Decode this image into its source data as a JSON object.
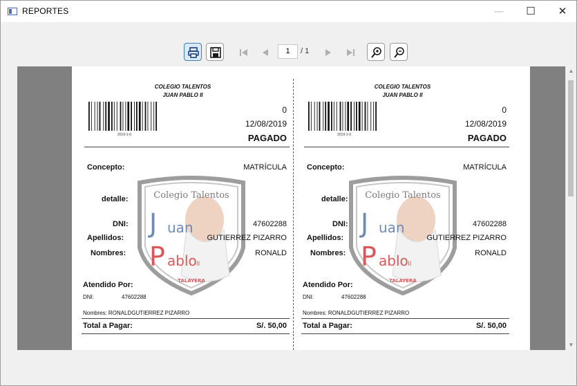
{
  "window": {
    "title": "REPORTES",
    "minimize": "—",
    "maximize": "☐",
    "close": "✕"
  },
  "toolbar": {
    "page_current": "1",
    "page_total": "/ 1"
  },
  "receipts": [
    {
      "school_line1": "COLEGIO TALENTOS",
      "school_line2": "JUAN PABLO II",
      "barcode_text": "2019-1-0",
      "number": "0",
      "date": "12/08/2019",
      "status": "PAGADO",
      "concepto_label": "Concepto:",
      "concepto_value": "MATRÍCULA",
      "detalle_label": "detalle:",
      "dni_label": "DNI:",
      "dni_value": "47602288",
      "apellidos_label": "Apellidos:",
      "apellidos_value": "GUTIERREZ PIZARRO",
      "nombres_label": "Nombres:",
      "nombres_value": "RONALD",
      "atendido_label": "Atendido Por:",
      "atendido_dni_label": "DNI:",
      "atendido_dni_value": "47602288",
      "atendido_nombres": "Nombres: RONALDGUTIERREZ PIZARRO",
      "total_label": "Total a Pagar:",
      "total_value": "S/. 50,00",
      "crest": {
        "top": "Colegio Talentos",
        "j": "J",
        "uan": "uan",
        "p": "P",
        "ablo": "ablo",
        "ii": "II",
        "bottom": "TALAYERA"
      }
    },
    {
      "school_line1": "COLEGIO TALENTOS",
      "school_line2": "JUAN PABLO II",
      "barcode_text": "2019-1-0",
      "number": "0",
      "date": "12/08/2019",
      "status": "PAGADO",
      "concepto_label": "Concepto:",
      "concepto_value": "MATRÍCULA",
      "detalle_label": "detalle:",
      "dni_label": "DNI:",
      "dni_value": "47602288",
      "apellidos_label": "Apellidos:",
      "apellidos_value": "GUTIERREZ PIZARRO",
      "nombres_label": "Nombres:",
      "nombres_value": "RONALD",
      "atendido_label": "Atendido Por:",
      "atendido_dni_label": "DNI:",
      "atendido_dni_value": "47602288",
      "atendido_nombres": "Nombres: RONALDGUTIERREZ PIZARRO",
      "total_label": "Total a Pagar:",
      "total_value": "S/. 50,00",
      "crest": {
        "top": "Colegio Talentos",
        "j": "J",
        "uan": "uan",
        "p": "P",
        "ablo": "ablo",
        "ii": "II",
        "bottom": "TALAYERA"
      }
    }
  ],
  "colors": {
    "accent": "#3c7fb1",
    "crest_red": "#d9595a",
    "crest_blue": "#6f8bb5",
    "viewer_bg": "#808080"
  }
}
